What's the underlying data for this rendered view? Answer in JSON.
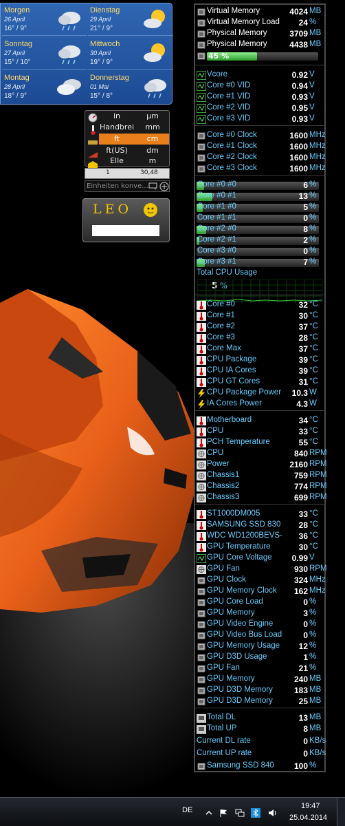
{
  "weather": {
    "days": [
      {
        "day": "Morgen",
        "date": "26 April",
        "temp": "16° / 9°",
        "icon": "rain-cloud-icon"
      },
      {
        "day": "Dienstag",
        "date": "29 April",
        "temp": "21° / 9°",
        "icon": "partly-sunny-icon"
      },
      {
        "day": "Sonntag",
        "date": "27 April",
        "temp": "15° / 10°",
        "icon": "rain-cloud-icon"
      },
      {
        "day": "Mittwoch",
        "date": "30 April",
        "temp": "19° / 9°",
        "icon": "partly-sunny-icon"
      },
      {
        "day": "Montag",
        "date": "28 April",
        "temp": "18° / 9°",
        "icon": "cloudy-icon"
      },
      {
        "day": "Donnerstag",
        "date": "01 Mai",
        "temp": "15° / 8°",
        "icon": "rain-cloud-icon"
      }
    ]
  },
  "converter": {
    "rows": [
      {
        "left": "in",
        "right": "µm"
      },
      {
        "left": "Handbrei",
        "right": "mm"
      },
      {
        "left": "ft",
        "right": "cm"
      },
      {
        "left": "ft(US)",
        "right": "dm"
      },
      {
        "left": "Elle",
        "right": "m"
      }
    ],
    "input_left": "1",
    "input_right": "30,48",
    "search_placeholder": "Einheiten konve..."
  },
  "leo": {
    "logo": "LEO"
  },
  "monitor": {
    "memory": [
      {
        "label": "Virtual Memory",
        "value": "4024",
        "unit": "MB"
      },
      {
        "label": "Virtual Memory Load",
        "value": "24",
        "unit": "%"
      },
      {
        "label": "Physical Memory",
        "value": "3709",
        "unit": "MB"
      },
      {
        "label": "Physical Memory",
        "value": "4438",
        "unit": "MB"
      }
    ],
    "memory_bar": {
      "label": "45 %",
      "percent": 45
    },
    "voltages": [
      {
        "label": "Vcore",
        "value": "0.92",
        "unit": "V"
      },
      {
        "label": "Core #0 VID",
        "value": "0.94",
        "unit": "V"
      },
      {
        "label": "Core #1 VID",
        "value": "0.93",
        "unit": "V"
      },
      {
        "label": "Core #2 VID",
        "value": "0.95",
        "unit": "V"
      },
      {
        "label": "Core #3 VID",
        "value": "0.93",
        "unit": "V"
      }
    ],
    "clocks": [
      {
        "label": "Core #0 Clock",
        "value": "1600",
        "unit": "MHz"
      },
      {
        "label": "Core #1 Clock",
        "value": "1600",
        "unit": "MHz"
      },
      {
        "label": "Core #2 Clock",
        "value": "1600",
        "unit": "MHz"
      },
      {
        "label": "Core #3 Clock",
        "value": "1600",
        "unit": "MHz"
      }
    ],
    "cores": [
      {
        "label": "Core #0 #0",
        "value": "6",
        "unit": "%"
      },
      {
        "label": "Core #0 #1",
        "value": "13",
        "unit": "%"
      },
      {
        "label": "Core #1 #0",
        "value": "5",
        "unit": "%"
      },
      {
        "label": "Core #1 #1",
        "value": "0",
        "unit": "%"
      },
      {
        "label": "Core #2 #0",
        "value": "8",
        "unit": "%"
      },
      {
        "label": "Core #2 #1",
        "value": "2",
        "unit": "%"
      },
      {
        "label": "Core #3 #0",
        "value": "0",
        "unit": "%"
      },
      {
        "label": "Core #3 #1",
        "value": "7",
        "unit": "%"
      }
    ],
    "total_cpu": {
      "label": "Total CPU Usage",
      "value": "5",
      "unit": "%"
    },
    "temps": [
      {
        "label": "Core #0",
        "value": "32",
        "unit": "°C",
        "icon": "thermometer-icon"
      },
      {
        "label": "Core #1",
        "value": "30",
        "unit": "°C",
        "icon": "thermometer-icon"
      },
      {
        "label": "Core #2",
        "value": "37",
        "unit": "°C",
        "icon": "thermometer-icon"
      },
      {
        "label": "Core #3",
        "value": "28",
        "unit": "°C",
        "icon": "thermometer-icon"
      },
      {
        "label": "Core Max",
        "value": "37",
        "unit": "°C",
        "icon": "thermometer-icon"
      },
      {
        "label": "CPU Package",
        "value": "39",
        "unit": "°C",
        "icon": "thermometer-icon"
      },
      {
        "label": "CPU IA Cores",
        "value": "39",
        "unit": "°C",
        "icon": "thermometer-icon"
      },
      {
        "label": "CPU GT Cores",
        "value": "31",
        "unit": "°C",
        "icon": "thermometer-icon"
      },
      {
        "label": "CPU Package Power",
        "value": "10.3",
        "unit": "W",
        "icon": "lightning-icon"
      },
      {
        "label": "IA Cores Power",
        "value": "4.3",
        "unit": "W",
        "icon": "lightning-icon"
      }
    ],
    "board": [
      {
        "label": "Motherboard",
        "value": "34",
        "unit": "°C",
        "icon": "thermometer-icon"
      },
      {
        "label": "CPU",
        "value": "33",
        "unit": "°C",
        "icon": "thermometer-icon"
      },
      {
        "label": "PCH Temperature",
        "value": "55",
        "unit": "°C",
        "icon": "thermometer-icon"
      },
      {
        "label": "CPU",
        "value": "840",
        "unit": "RPM",
        "icon": "fan-icon"
      },
      {
        "label": "Power",
        "value": "2160",
        "unit": "RPM",
        "icon": "fan-icon"
      },
      {
        "label": "Chassis1",
        "value": "759",
        "unit": "RPM",
        "icon": "fan-icon"
      },
      {
        "label": "Chassis2",
        "value": "774",
        "unit": "RPM",
        "icon": "fan-icon"
      },
      {
        "label": "Chassis3",
        "value": "699",
        "unit": "RPM",
        "icon": "fan-icon"
      }
    ],
    "drives_gpu": [
      {
        "label": "ST1000DM005",
        "value": "33",
        "unit": "°C",
        "icon": "thermometer-icon"
      },
      {
        "label": "SAMSUNG SSD 830",
        "value": "28",
        "unit": "°C",
        "icon": "thermometer-icon"
      },
      {
        "label": "WDC WD1200BEVS-",
        "value": "36",
        "unit": "°C",
        "icon": "thermometer-icon"
      },
      {
        "label": "GPU Temperature",
        "value": "30",
        "unit": "°C",
        "icon": "thermometer-icon"
      },
      {
        "label": "GPU Core Voltage",
        "value": "0.99",
        "unit": "V",
        "icon": "voltage-icon"
      },
      {
        "label": "GPU Fan",
        "value": "930",
        "unit": "RPM",
        "icon": "fan-icon"
      },
      {
        "label": "GPU Clock",
        "value": "324",
        "unit": "MHz",
        "icon": "chip-icon"
      },
      {
        "label": "GPU Memory Clock",
        "value": "162",
        "unit": "MHz",
        "icon": "chip-icon"
      },
      {
        "label": "GPU Core Load",
        "value": "0",
        "unit": "%",
        "icon": "chip-icon"
      },
      {
        "label": "GPU Memory",
        "value": "3",
        "unit": "%",
        "icon": "chip-icon"
      },
      {
        "label": "GPU Video Engine",
        "value": "0",
        "unit": "%",
        "icon": "chip-icon"
      },
      {
        "label": "GPU Video Bus Load",
        "value": "0",
        "unit": "%",
        "icon": "chip-icon"
      },
      {
        "label": "GPU Memory Usage",
        "value": "12",
        "unit": "%",
        "icon": "chip-icon"
      },
      {
        "label": "GPU D3D Usage",
        "value": "1",
        "unit": "%",
        "icon": "chip-icon"
      },
      {
        "label": "GPU Fan",
        "value": "21",
        "unit": "%",
        "icon": "chip-icon"
      },
      {
        "label": "GPU Memory",
        "value": "240",
        "unit": "MB",
        "icon": "chip-icon"
      },
      {
        "label": "GPU D3D Memory",
        "value": "183",
        "unit": "MB",
        "icon": "chip-icon"
      },
      {
        "label": "GPU D3D Memory",
        "value": "25",
        "unit": "MB",
        "icon": "chip-icon"
      }
    ],
    "network": [
      {
        "label": "Total DL",
        "value": "13",
        "unit": "MB",
        "icon": "network-icon"
      },
      {
        "label": "Total UP",
        "value": "8",
        "unit": "MB",
        "icon": "network-icon"
      },
      {
        "label": "Current DL rate",
        "value": "0",
        "unit": "KB/s",
        "icon": ""
      },
      {
        "label": "Current UP rate",
        "value": "0",
        "unit": "KB/s",
        "icon": ""
      },
      {
        "label": "Samsung SSD 840",
        "value": "100",
        "unit": "%",
        "icon": "chip-icon"
      }
    ]
  },
  "taskbar": {
    "language": "DE",
    "time": "19:47",
    "date": "25.04.2014",
    "tray_icons": [
      "chevron-up-icon",
      "flag-icon",
      "network-icon",
      "bluetooth-icon",
      "speaker-icon"
    ]
  },
  "colors": {
    "accent": "#66ccff",
    "bar": "#3fbf3f",
    "weather_bg": "#1c4a93",
    "car": "#e8601a"
  }
}
